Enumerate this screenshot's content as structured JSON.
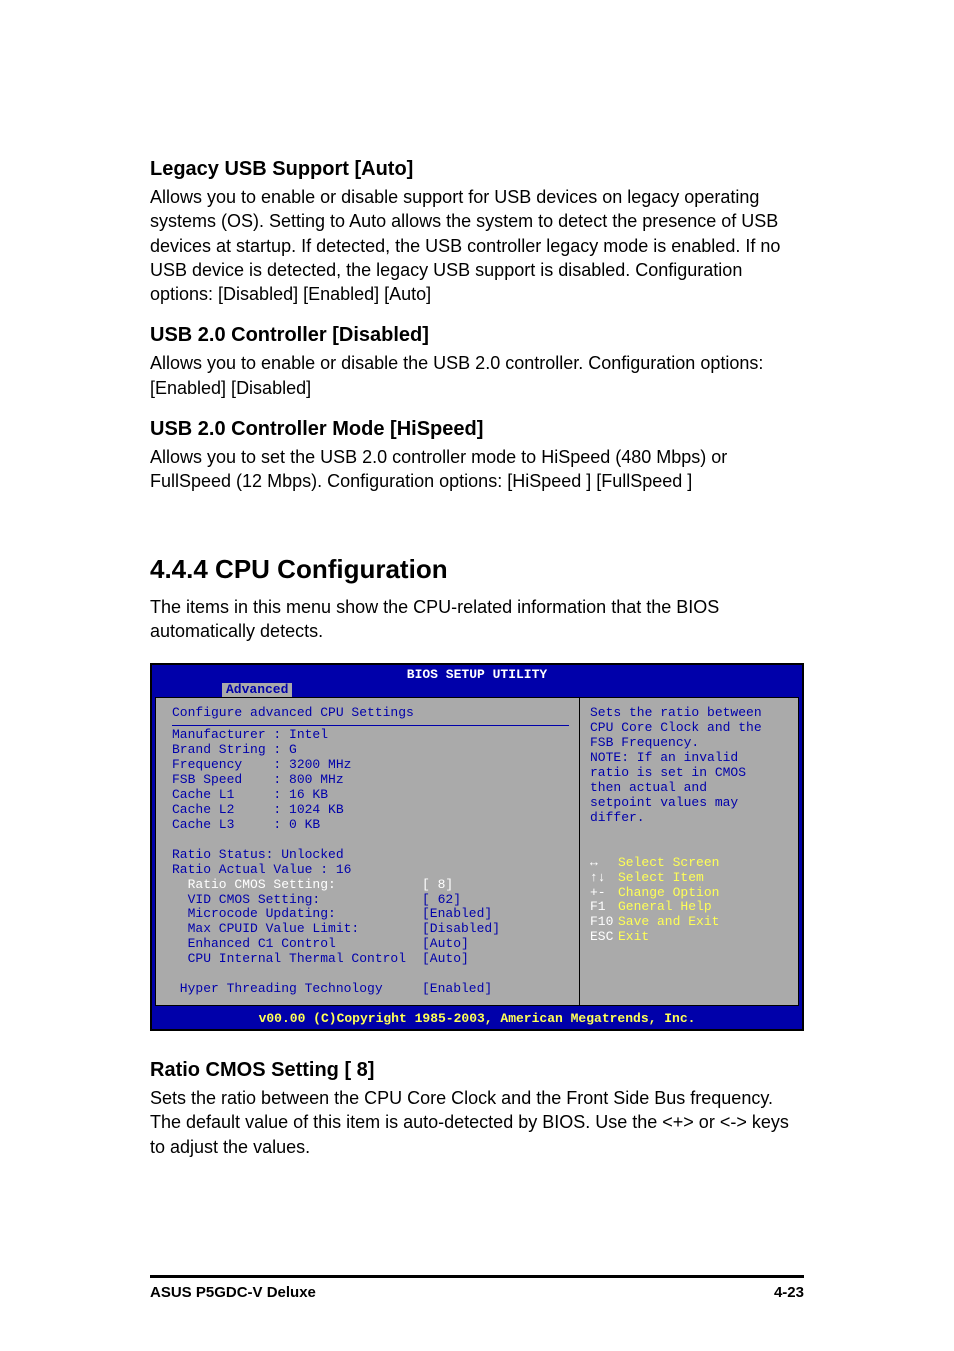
{
  "s1": {
    "title": "Legacy USB Support [Auto]",
    "body": "Allows you to enable or disable support for USB devices on legacy operating systems (OS). Setting to Auto allows the system to detect the presence of USB devices at startup. If detected, the USB controller legacy mode is enabled. If no USB device is detected, the legacy USB support is disabled. Configuration options: [Disabled] [Enabled] [Auto]"
  },
  "s2": {
    "title": "USB 2.0 Controller [Disabled]",
    "body": "Allows you to enable or disable the USB 2.0 controller. Configuration options: [Enabled] [Disabled]"
  },
  "s3": {
    "title": "USB 2.0 Controller Mode [HiSpeed]",
    "body": "Allows you to set the USB 2.0 controller mode to HiSpeed (480 Mbps) or FullSpeed (12 Mbps). Configuration options: [HiSpeed ] [FullSpeed ]"
  },
  "section": {
    "number_title": "4.4.4   CPU Configuration",
    "intro": "The items in this menu show the CPU-related information that the BIOS automatically detects."
  },
  "bios": {
    "title": "BIOS SETUP UTILITY",
    "tab": "Advanced",
    "heading": "Configure advanced CPU Settings",
    "info": [
      "Manufacturer : Intel",
      "Brand String : G",
      "Frequency    : 3200 MHz",
      "FSB Speed    : 800 MHz"
    ],
    "cache": [
      "Cache L1     : 16 KB",
      "Cache L2     : 1024 KB",
      "Cache L3     : 0 KB"
    ],
    "ratio_status": "Ratio Status: Unlocked",
    "ratio_actual": "Ratio Actual Value : 16",
    "settings": [
      {
        "label": "  Ratio CMOS Setting:",
        "val": "[ 8]"
      },
      {
        "label": "  VID CMOS Setting:",
        "val": "[ 62]"
      },
      {
        "label": "  Microcode Updating:",
        "val": "[Enabled]"
      },
      {
        "label": "  Max CPUID Value Limit:",
        "val": "[Disabled]"
      },
      {
        "label": "  Enhanced C1 Control",
        "val": "[Auto]"
      },
      {
        "label": "  CPU Internal Thermal Control",
        "val": "[Auto]"
      }
    ],
    "hyper": {
      "label": " Hyper Threading Technology",
      "val": "[Enabled]"
    },
    "help": "Sets the ratio between\nCPU Core Clock and the\nFSB Frequency.\nNOTE: If an invalid\nratio is set in CMOS\nthen actual and\nsetpoint values may\ndiffer.",
    "nav": [
      {
        "key": "↔",
        "label": "Select Screen"
      },
      {
        "key": "↑↓",
        "label": "Select Item"
      },
      {
        "key": "+-",
        "label": "Change Option"
      },
      {
        "key": "F1",
        "label": "General Help"
      },
      {
        "key": "F10",
        "label": "Save and Exit"
      },
      {
        "key": "ESC",
        "label": "Exit"
      }
    ],
    "copyright": "v00.00 (C)Copyright 1985-2003, American Megatrends, Inc."
  },
  "s4": {
    "title": "Ratio CMOS Setting [ 8]",
    "body": "Sets the ratio between the CPU Core Clock and the Front Side Bus frequency. The default value of this item is auto-detected by BIOS. Use the <+> or <-> keys to adjust the values."
  },
  "footer": {
    "left": "ASUS P5GDC-V Deluxe",
    "right": "4-23"
  }
}
